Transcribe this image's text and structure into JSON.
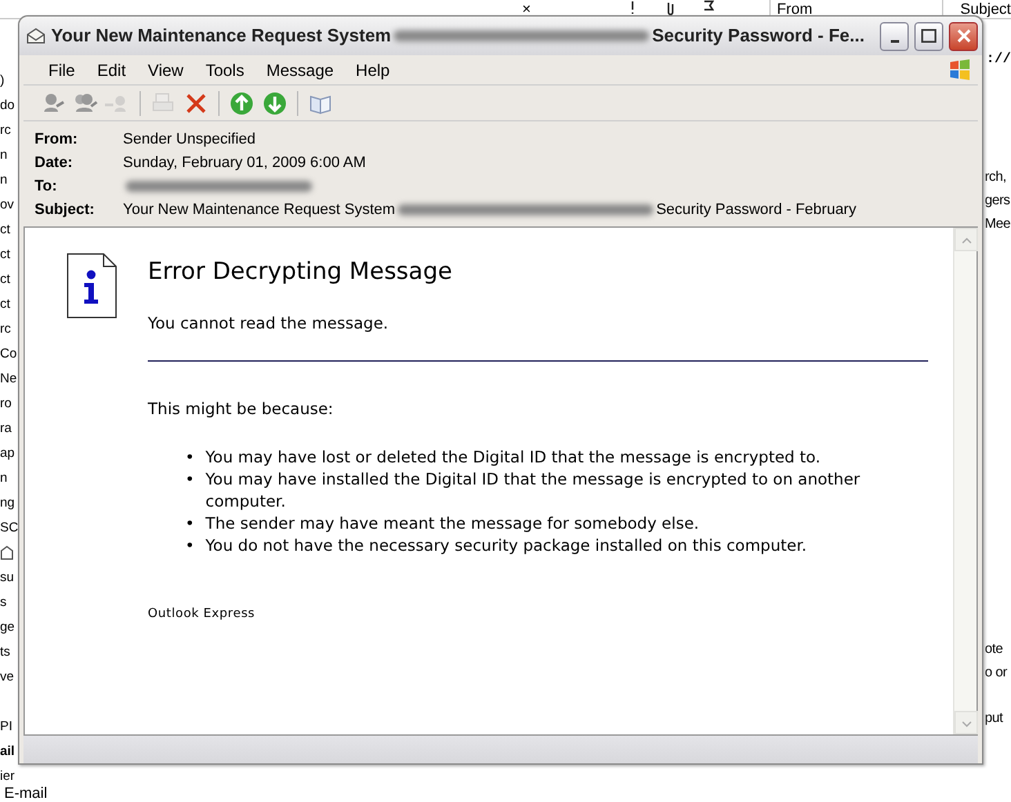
{
  "background_app": {
    "close_mark": "×",
    "columns": [
      "From",
      "Subject"
    ],
    "left_fragments": [
      ")",
      "do",
      "rc",
      "n",
      "n",
      "ov",
      "ct",
      "ct",
      "ct",
      "ct",
      "rc",
      "Co",
      "Ne",
      "ro",
      "ra",
      "ap",
      "n",
      "ng",
      "SC"
    ],
    "left_fragments_2": [
      "su",
      "s",
      "ge",
      "ts",
      "ve"
    ],
    "left_fragments_3": [
      "PI"
    ],
    "bold_fragment": "ail",
    "left_fragment_last": "ier",
    "bottom_fragment": "E-mail",
    "url_fragment": "://",
    "right_fragments": [
      "rch,",
      "gers",
      "Mee"
    ],
    "right_lower_fragments": [
      "ote",
      "o or"
    ],
    "right_last_fragment": "put"
  },
  "window": {
    "title_parts": [
      {
        "kind": "text",
        "text": "Your New Maintenance Request System"
      },
      {
        "kind": "redacted"
      },
      {
        "kind": "text",
        "text": "Security Password - Fe..."
      }
    ]
  },
  "menu": [
    "File",
    "Edit",
    "View",
    "Tools",
    "Message",
    "Help"
  ],
  "toolbar": [
    {
      "kind": "reply",
      "disabled": false
    },
    {
      "kind": "reply-all",
      "disabled": false
    },
    {
      "kind": "forward",
      "disabled": true
    },
    {
      "kind": "separator"
    },
    {
      "kind": "print",
      "disabled": true
    },
    {
      "kind": "delete",
      "disabled": false
    },
    {
      "kind": "separator"
    },
    {
      "kind": "previous",
      "disabled": false
    },
    {
      "kind": "next",
      "disabled": false
    },
    {
      "kind": "separator"
    },
    {
      "kind": "address-book",
      "disabled": false
    }
  ],
  "headers": [
    {
      "label": "From:",
      "value": [
        {
          "kind": "text",
          "text": "Sender Unspecified"
        }
      ]
    },
    {
      "label": "Date:",
      "value": [
        {
          "kind": "text",
          "text": "Sunday, February 01, 2009 6:00 AM"
        }
      ]
    },
    {
      "label": "To:",
      "value": [
        {
          "kind": "redacted"
        }
      ]
    },
    {
      "label": "Subject:",
      "value": [
        {
          "kind": "text",
          "text": "Your New Maintenance Request System"
        },
        {
          "kind": "redacted"
        },
        {
          "kind": "text",
          "text": "Security Password - February"
        }
      ]
    }
  ],
  "message": {
    "bullet": "•",
    "title": "Error Decrypting Message",
    "subtitle": "You cannot read the message.",
    "intro": "This might be because:",
    "reasons": [
      "You may have lost or deleted the Digital ID that the message is encrypted to.",
      "You may have installed the Digital ID that the message is encrypted to on another computer.",
      "The sender may have meant the message for somebody else.",
      "You do not have the necessary security package installed on this computer."
    ],
    "footer": "Outlook Express"
  }
}
